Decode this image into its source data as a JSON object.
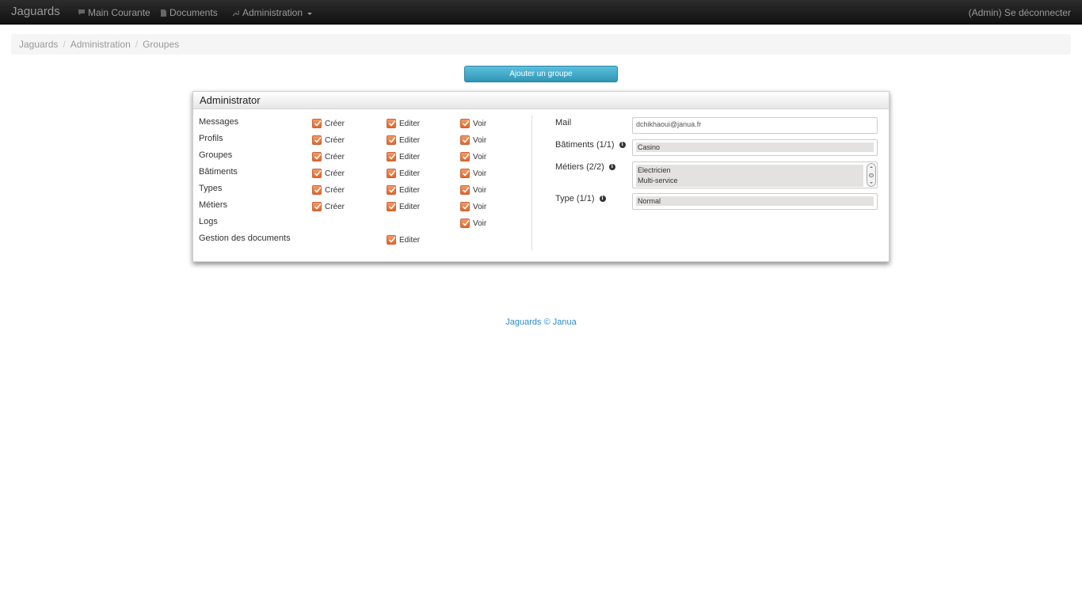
{
  "navbar": {
    "brand": "Jaguards",
    "items": [
      {
        "label": "Main Courante",
        "icon": "comment-icon"
      },
      {
        "label": "Documents",
        "icon": "file-icon"
      },
      {
        "label": "Administration",
        "icon": "wrench-icon"
      }
    ],
    "logout": "(Admin) Se déconnecter"
  },
  "breadcrumb": [
    "Jaguards",
    "Administration",
    "Groupes"
  ],
  "add_button": "Ajouter un groupe",
  "group": {
    "title": "Administrator",
    "permissions": [
      {
        "label": "Messages",
        "create": "Créer",
        "edit": "Editer",
        "view": "Voir"
      },
      {
        "label": "Profils",
        "create": "Créer",
        "edit": "Editer",
        "view": "Voir"
      },
      {
        "label": "Groupes",
        "create": "Créer",
        "edit": "Editer",
        "view": "Voir"
      },
      {
        "label": "Bâtiments",
        "create": "Créer",
        "edit": "Editer",
        "view": "Voir"
      },
      {
        "label": "Types",
        "create": "Créer",
        "edit": "Editer",
        "view": "Voir"
      },
      {
        "label": "Métiers",
        "create": "Créer",
        "edit": "Editer",
        "view": "Voir"
      },
      {
        "label": "Logs",
        "create": "",
        "edit": "",
        "view": "Voir"
      },
      {
        "label": "Gestion des documents",
        "create": "",
        "edit": "Editer",
        "view": ""
      }
    ],
    "fields": {
      "mail_label": "Mail",
      "mail_value": "dchikhaoui@janua.fr",
      "batiments_label": "Bâtiments (1/1)",
      "batiments": [
        "Casino"
      ],
      "metiers_label": "Métiers (2/2)",
      "metiers": [
        "Electricien",
        "Multi-service"
      ],
      "type_label": "Type (1/1)",
      "type": [
        "Normal"
      ]
    }
  },
  "footer": "Jaguards © Janua",
  "colors": {
    "navbar": "#1b1b1b",
    "button": "#49afcd",
    "checkbox": "#e8733c",
    "footer_link": "#2a8ccb"
  }
}
